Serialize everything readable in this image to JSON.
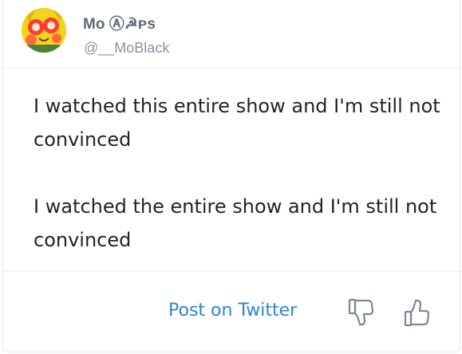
{
  "author": {
    "display_name": "Mo Ⓐ☭ᴘs",
    "handle": "@__MoBlack",
    "avatar_icon": "pikachu-avatar"
  },
  "tweet": {
    "paragraphs": [
      "I watched this entire show and I'm still not convinced",
      "I watched the entire show and I'm still not convinced"
    ]
  },
  "footer": {
    "post_link_label": "Post on Twitter",
    "vote_down_icon": "thumbs-down-icon",
    "vote_up_icon": "thumbs-up-icon"
  },
  "colors": {
    "link": "#2a86cc",
    "name": "#5e6a75",
    "handle": "#8a96a1",
    "body_text": "#1f2328",
    "icon": "#7c8894"
  }
}
